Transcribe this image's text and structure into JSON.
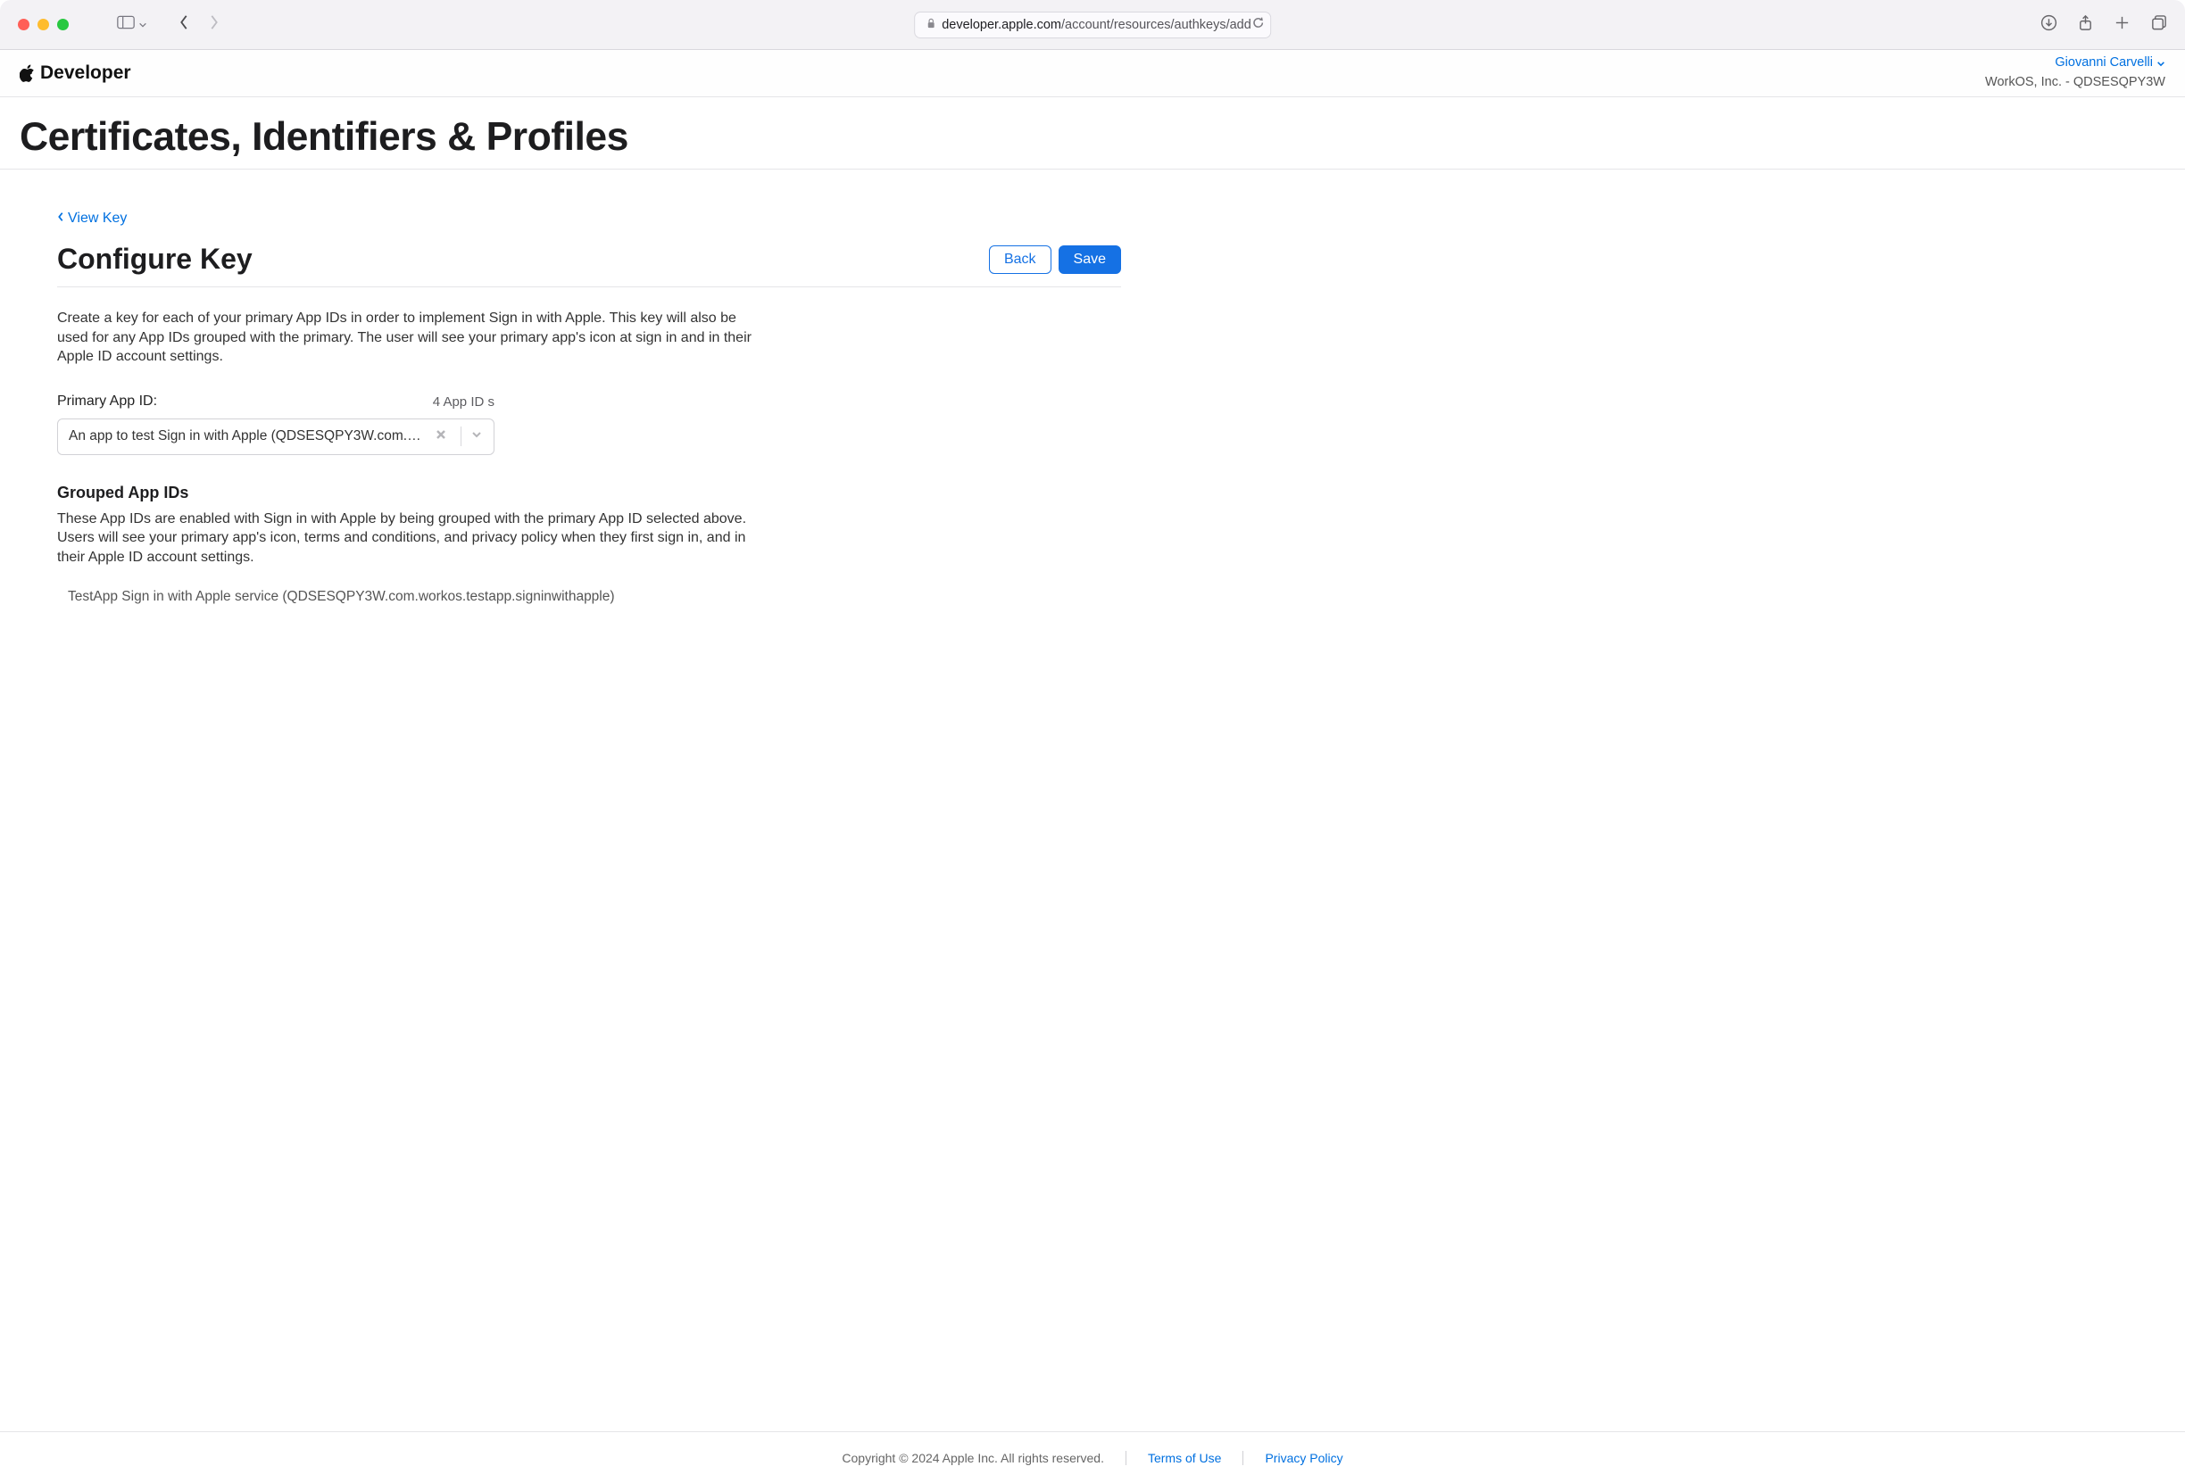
{
  "browser": {
    "url_host": "developer.apple.com",
    "url_path": "/account/resources/authkeys/add"
  },
  "nav": {
    "brand": "Developer",
    "account_name": "Giovanni Carvelli",
    "team_label": "WorkOS, Inc. - QDSESQPY3W"
  },
  "page": {
    "title": "Certificates, Identifiers & Profiles",
    "back_link": "View Key",
    "section_title": "Configure Key",
    "back_button": "Back",
    "save_button": "Save",
    "description": "Create a key for each of your primary App IDs in order to implement Sign in with Apple. This key will also be used for any App IDs grouped with the primary. The user will see your primary app's icon at sign in and in their Apple ID account settings.",
    "primary_app_id_label": "Primary App ID:",
    "app_id_count": "4 App ID s",
    "primary_app_selected": "An app to test Sign in with Apple (QDSESQPY3W.com.worko...",
    "grouped_heading": "Grouped App IDs",
    "grouped_desc": "These App IDs are enabled with Sign in with Apple by being grouped with the primary App ID selected above. Users will see your primary app's icon, terms and conditions, and privacy policy when they first sign in, and in their Apple ID account settings.",
    "grouped_items": [
      "TestApp Sign in with Apple service (QDSESQPY3W.com.workos.testapp.signinwithapple)"
    ]
  },
  "footer": {
    "copyright": "Copyright © 2024 Apple Inc. All rights reserved.",
    "terms": "Terms of Use",
    "privacy": "Privacy Policy"
  }
}
